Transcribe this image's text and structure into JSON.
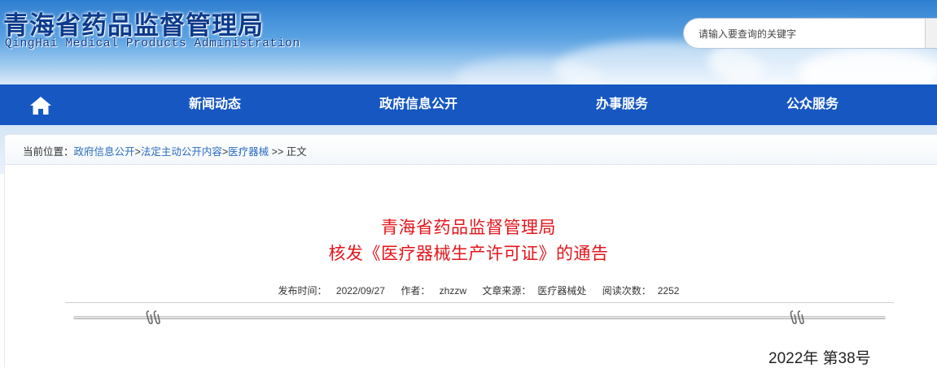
{
  "header": {
    "site_title": "青海省药品监督管理局",
    "site_subtitle": "QingHai Medical Products Administration",
    "search_placeholder": "请输入要查询的关键字"
  },
  "nav": {
    "home_icon": "home-icon",
    "items": [
      "新闻动态",
      "政府信息公开",
      "办事服务",
      "公众服务"
    ]
  },
  "breadcrumb": {
    "prefix": "当前位置：",
    "links": [
      "政府信息公开",
      "法定主动公开内容",
      "医疗器械"
    ],
    "separator": ">",
    "tail_separator": ">>",
    "current": "正文"
  },
  "article": {
    "title_line1": "青海省药品监督管理局",
    "title_line2": "核发《医疗器械生产许可证》的通告",
    "meta": {
      "published_label": "发布时间：",
      "published_value": "2022/09/27",
      "author_label": "作者：",
      "author_value": "zhzzw",
      "source_label": "文章来源：",
      "source_value": "医疗器械处",
      "views_label": "阅读次数：",
      "views_value": "2252"
    },
    "doc_number": "2022年  第38号"
  },
  "colors": {
    "nav_bg": "#1657c2",
    "title_red": "#e3141b",
    "site_title_blue": "#0c3a8c",
    "link_blue": "#2a6bbf"
  }
}
